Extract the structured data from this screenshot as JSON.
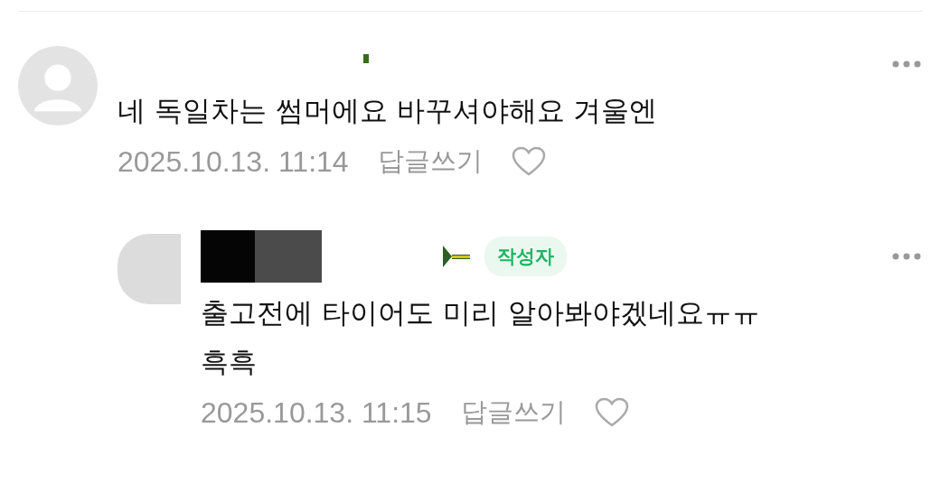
{
  "comments": [
    {
      "body": "네 독일차는 썸머에요 바꾸셔야해요 겨울엔",
      "date": "2025.10.13. 11:14",
      "reply_label": "답글쓰기",
      "liked": false,
      "children": [
        {
          "badge": "작성자",
          "body": "출고전에 타이어도 미리 알아봐야겠네요ㅠㅠ 흑흑",
          "date": "2025.10.13. 11:15",
          "reply_label": "답글쓰기",
          "liked": false
        }
      ]
    }
  ]
}
